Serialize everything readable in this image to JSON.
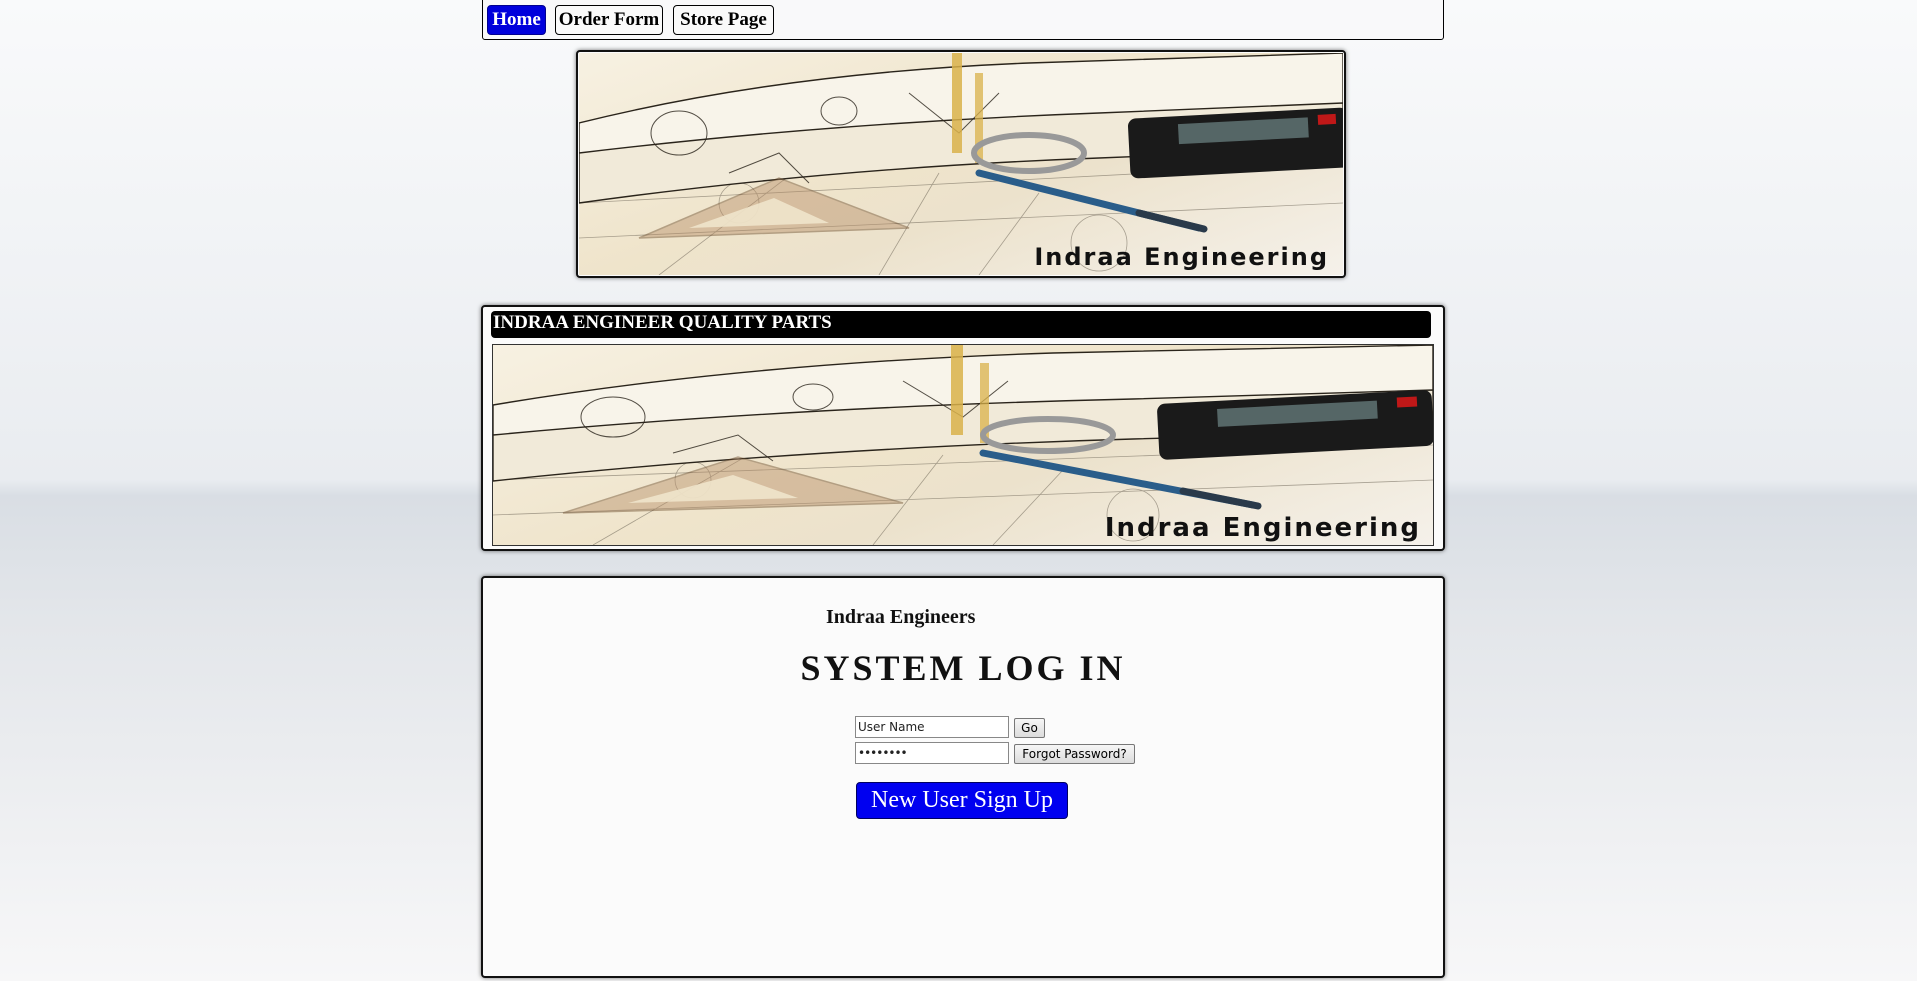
{
  "nav": {
    "items": [
      {
        "label": "Home",
        "active": true
      },
      {
        "label": "Order Form",
        "active": false
      },
      {
        "label": "Store Page",
        "active": false
      }
    ],
    "active_color": "#0000dc"
  },
  "banner": {
    "caption": "Indraa Engineering"
  },
  "parts_section": {
    "title": "INDRAA ENGINEER QUALITY PARTS",
    "banner_caption": "Indraa Engineering"
  },
  "login": {
    "company": "Indraa Engineers",
    "heading": "SYSTEM LOG IN",
    "username_value": "User Name",
    "password_value": "••••••••",
    "go_label": "Go",
    "forgot_label": "Forgot Password?",
    "signup_label": "New User Sign Up",
    "signup_color": "#0000f0"
  }
}
